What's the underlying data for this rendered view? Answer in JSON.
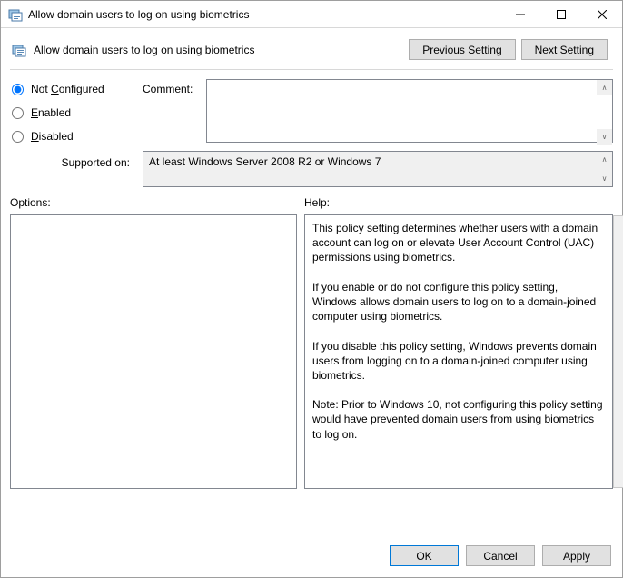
{
  "window": {
    "title": "Allow domain users to log on using biometrics"
  },
  "subheader": {
    "title": "Allow domain users to log on using biometrics",
    "previous": "Previous Setting",
    "next": "Next Setting"
  },
  "radios": {
    "not_configured_prefix": "Not ",
    "not_configured_underline": "C",
    "not_configured_suffix": "onfigured",
    "enabled_underline": "E",
    "enabled_suffix": "nabled",
    "disabled_underline": "D",
    "disabled_suffix": "isabled"
  },
  "comment": {
    "label": "Comment:",
    "value": ""
  },
  "supported": {
    "label": "Supported on:",
    "value": "At least Windows Server 2008 R2 or Windows 7"
  },
  "labels": {
    "options": "Options:",
    "help": "Help:"
  },
  "help": {
    "p1": "This policy setting determines whether users with a domain account can log on or elevate User Account Control (UAC) permissions using biometrics.",
    "p2": "If you enable or do not configure this policy setting, Windows allows domain users to log on to a domain-joined computer using biometrics.",
    "p3": "If you disable this policy setting, Windows prevents domain users from logging on to a domain-joined computer using biometrics.",
    "p4": "Note: Prior to Windows 10, not configuring this policy setting would have prevented domain users from using biometrics to log on."
  },
  "footer": {
    "ok": "OK",
    "cancel": "Cancel",
    "apply": "Apply"
  }
}
